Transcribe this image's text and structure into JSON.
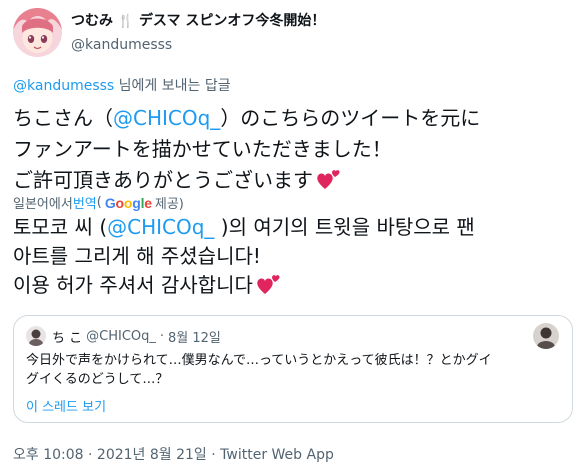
{
  "author": {
    "display_name": "つむみ",
    "display_name_suffix": "デスマ スピンオフ今冬開始！",
    "handle": "@kandumesss"
  },
  "reply_to": {
    "mention": "@kandumesss",
    "suffix": " 님에게 보내는 답글"
  },
  "tweet": {
    "line1_pre": "ちこさん（",
    "line1_mention": "@CHICOq_",
    "line1_post": "）のこちらのツイートを元に",
    "line2": "ファンアートを描かせていただきました！",
    "line3": "ご許可頂きありがとうございます"
  },
  "translate": {
    "from_text": "일본어에서 ",
    "link_text": "번역",
    "by_text": "(",
    "provider_letters": [
      "G",
      "o",
      "o",
      "g",
      "l",
      "e"
    ],
    "provided_text": " 제공)"
  },
  "translated": {
    "line1_pre": "토모코 씨 (",
    "line1_mention": "@CHICOq_",
    "line1_post": " )의 여기의 트윗을 바탕으로 팬",
    "line2": "아트를 그리게 해 주셨습니다!",
    "line3": " 이용 허가 주셔서 감사합니다"
  },
  "quote": {
    "name": "ち こ",
    "handle": "@CHICOq_",
    "separator": "·",
    "date": "8월 12일",
    "line1": "今日外で声をかけられて…僕男なんで…っていうとかえって彼氏は！？とかグイ",
    "line2": "グイくるのどうして…？",
    "thread_link": "이 스레드 보기"
  },
  "meta": {
    "timestamp": "오후 10:08 · 2021년 8월 21일 · Twitter Web App"
  },
  "colors": {
    "link": "#1d9bf0",
    "muted": "#536471",
    "heart": "#e0245e",
    "border": "#cfd9de"
  },
  "icons": {
    "utensils": "fork-knife-icon",
    "heart": "two-hearts-icon"
  }
}
